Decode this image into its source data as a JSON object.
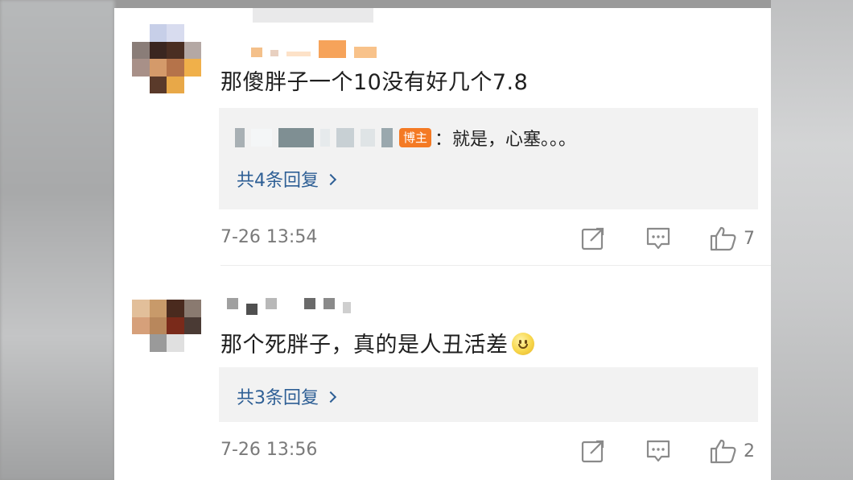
{
  "comments": [
    {
      "text": "那傻胖子一个10没有好几个7.8",
      "sub_reply": {
        "badge": "博主",
        "text": "：就是，心塞。。。"
      },
      "more_replies": "共4条回复",
      "timestamp": "7-26 13:54",
      "likes": "7"
    },
    {
      "text": "那个死胖子，真的是人丑活差",
      "emoji": "smile-emoji",
      "more_replies": "共3条回复",
      "timestamp": "7-26 13:56",
      "likes": "2"
    }
  ],
  "icons": {
    "share": "share-icon",
    "comment": "comment-icon",
    "like": "thumbs-up-icon",
    "chevron": "chevron-right-icon"
  },
  "colors": {
    "link": "#2e5f95",
    "badge": "#f47a24",
    "reply_bg": "#f2f2f2",
    "muted": "#7a7a7a"
  }
}
